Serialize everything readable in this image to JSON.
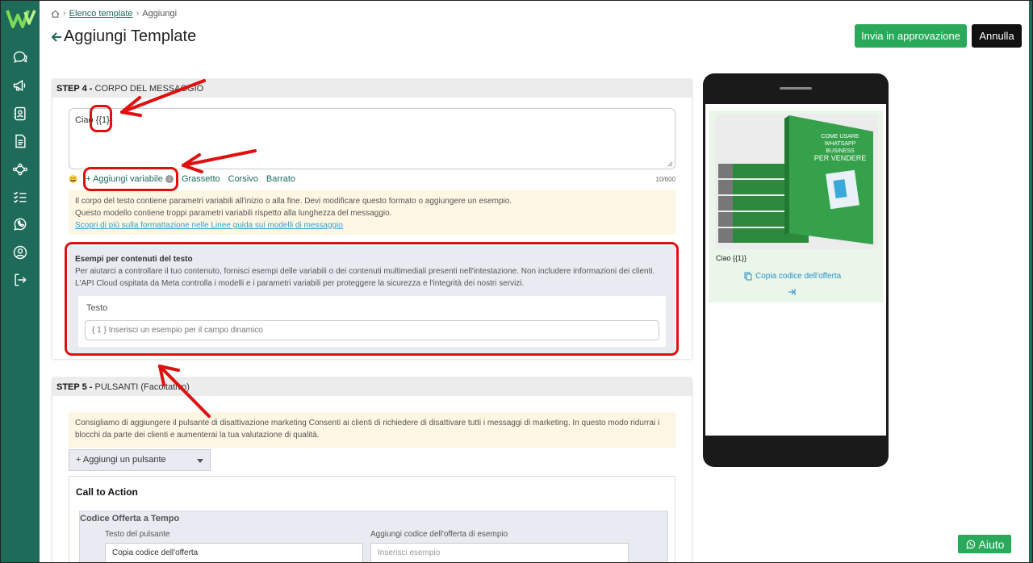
{
  "breadcrumb": {
    "home_icon": "home-icon",
    "parent": "Elenco template",
    "current": "Aggiungi"
  },
  "page_title": "Aggiungi Template",
  "header_buttons": {
    "approve": "Invia in approvazione",
    "cancel": "Annulla"
  },
  "sidebar_icons": [
    "chat-icon",
    "megaphone-icon",
    "contacts-icon",
    "document-icon",
    "flow-icon",
    "checklist-icon",
    "whatsapp-icon",
    "user-icon",
    "logout-icon"
  ],
  "step4": {
    "label_step": "STEP 4 -",
    "label_name": "CORPO DEL MESSAGGIO",
    "message_text": "Ciao {{1}}",
    "toolbar": {
      "emoji": "😀",
      "add_variable": "+ Aggiungi variabile",
      "bold": "Grassetto",
      "italic": "Corsivo",
      "strike": "Barrato",
      "counter": "10/600"
    },
    "warning_lines": [
      "Il corpo del testo contiene parametri variabili all'inizio o alla fine. Devi modificare questo formato o aggiungere un esempio.",
      "Questo modello contiene troppi parametri variabili rispetto alla lunghezza del messaggio."
    ],
    "warning_link": "Scopri di più sulla formattazione nelle Linee guida sui modelli di messaggio",
    "examples": {
      "title": "Esempi per contenuti del testo",
      "line1": "Per aiutarci a controllare il tuo contenuto, fornisci esempi delle variabili o dei contenuti multimediali presenti nell'intestazione. Non includere informazioni dei clienti.",
      "line2": "L'API Cloud ospitata da Meta controlla i modelli e i parametri variabili per proteggere la sicurezza e l'integrità dei nostri servizi.",
      "field_label": "Testo",
      "placeholder": "{ 1 } Inserisci un esempio per il campo dinamico"
    }
  },
  "step5": {
    "label_step": "STEP 5 -",
    "label_name": "PULSANTI (Facoltativo)",
    "warning": "Consigliamo di aggiungere il pulsante di disattivazione marketing Consenti ai clienti di richiedere di disattivare tutti i messaggi di marketing. In questo modo ridurrai i blocchi da parte dei clienti e aumenterai la tua valutazione di qualità.",
    "add_button": "+ Aggiungi un pulsante",
    "cta_title": "Call to Action",
    "offer_title": "Codice Offerta a Tempo",
    "button_text_label": "Testo del pulsante",
    "button_text_value": "Copia codice dell'offerta",
    "example_label": "Aggiungi codice dell'offerta di esempio",
    "example_placeholder": "Inserisci esempio"
  },
  "preview": {
    "book_title_1": "COME USARE",
    "book_title_2": "WHATSAPP BUSINESS",
    "book_title_3": "PER VENDERE",
    "message": "Ciao {{1}}",
    "copy_button": "Copia codice dell'offerta"
  },
  "help_button": "Aiuto",
  "colors": {
    "brand": "#1e6b5a",
    "accent": "#2aa95a",
    "annotation": "#e01010"
  }
}
